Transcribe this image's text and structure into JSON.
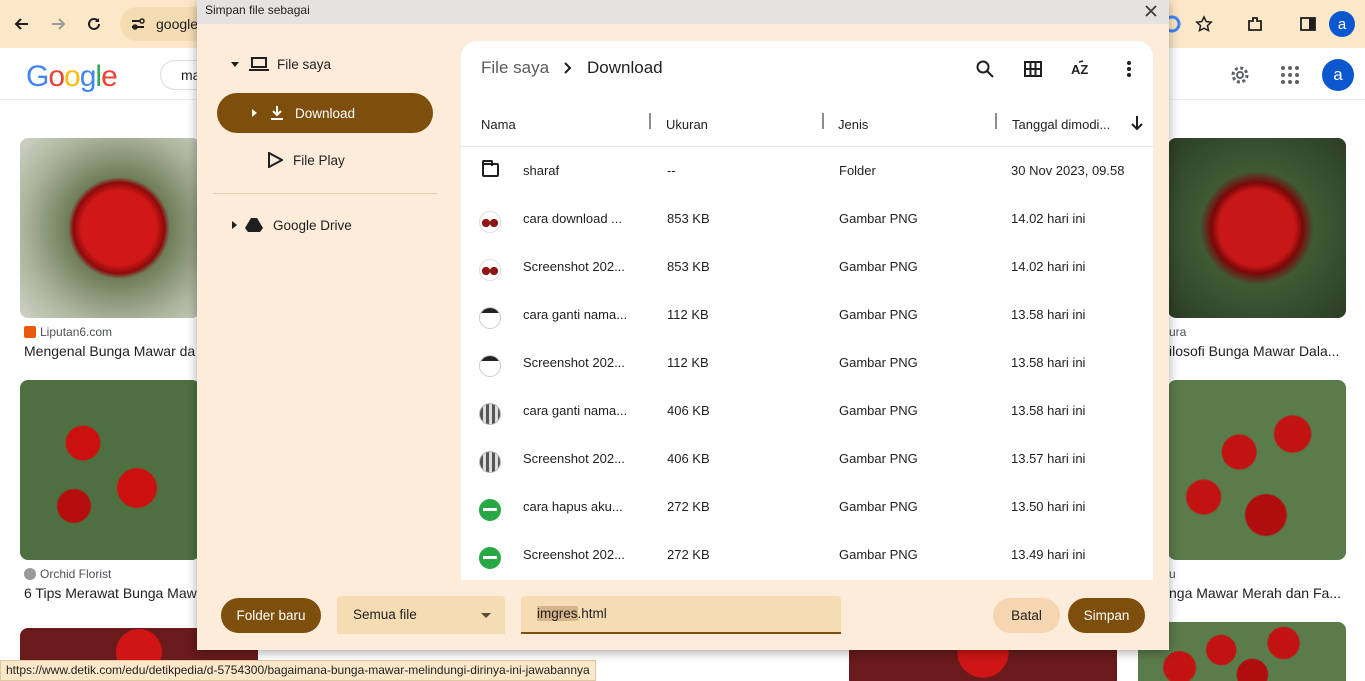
{
  "browser": {
    "omnibox_text": "google",
    "profile_initial": "a"
  },
  "google_page": {
    "search_text": "ma",
    "avatar_initial": "a",
    "results": [
      {
        "source": "Liputan6.com",
        "title": "Mengenal Bunga Mawar da"
      },
      {
        "source": "Orchid Florist",
        "title": "6 Tips Merawat Bunga Maw"
      },
      {
        "source": "ura",
        "title": "ilosofi Bunga Mawar Dala..."
      },
      {
        "source": "u",
        "title": "nga Mawar Merah dan Fa..."
      }
    ]
  },
  "dialog": {
    "title": "Simpan file sebagai",
    "nav": {
      "items": [
        {
          "label": "File saya",
          "icon": "laptop-icon"
        },
        {
          "label": "Download",
          "icon": "download-icon"
        },
        {
          "label": "File Play",
          "icon": "play-store-icon"
        },
        {
          "label": "Google Drive",
          "icon": "google-drive-icon"
        }
      ]
    },
    "breadcrumb": {
      "root": "File saya",
      "current": "Download"
    },
    "columns": {
      "name": "Nama",
      "size": "Ukuran",
      "type": "Jenis",
      "modified": "Tanggal dimodi..."
    },
    "files": [
      {
        "name": "sharaf",
        "size": "--",
        "type": "Folder",
        "modified": "30 Nov 2023, 09.58",
        "thumb": "folder"
      },
      {
        "name": "cara download ...",
        "size": "853 KB",
        "type": "Gambar PNG",
        "modified": "14.02 hari ini",
        "thumb": "rose"
      },
      {
        "name": "Screenshot 202...",
        "size": "853 KB",
        "type": "Gambar PNG",
        "modified": "14.02 hari ini",
        "thumb": "rose"
      },
      {
        "name": "cara ganti nama...",
        "size": "112 KB",
        "type": "Gambar PNG",
        "modified": "13.58 hari ini",
        "thumb": "win"
      },
      {
        "name": "Screenshot 202...",
        "size": "112 KB",
        "type": "Gambar PNG",
        "modified": "13.58 hari ini",
        "thumb": "win"
      },
      {
        "name": "cara ganti nama...",
        "size": "406 KB",
        "type": "Gambar PNG",
        "modified": "13.58 hari ini",
        "thumb": "grid"
      },
      {
        "name": "Screenshot 202...",
        "size": "406 KB",
        "type": "Gambar PNG",
        "modified": "13.57 hari ini",
        "thumb": "grid"
      },
      {
        "name": "cara hapus aku...",
        "size": "272 KB",
        "type": "Gambar PNG",
        "modified": "13.50 hari ini",
        "thumb": "green"
      },
      {
        "name": "Screenshot 202...",
        "size": "272 KB",
        "type": "Gambar PNG",
        "modified": "13.49 hari ini",
        "thumb": "green"
      }
    ],
    "footer": {
      "new_folder_label": "Folder baru",
      "file_type_value": "Semua file",
      "filename_selected": "imgres",
      "filename_ext": ".html",
      "cancel_label": "Batal",
      "save_label": "Simpan"
    }
  },
  "status_url": "https://www.detik.com/edu/detikpedia/d-5754300/bagaimana-bunga-mawar-melindungi-dirinya-ini-jawabannya",
  "colors": {
    "accent": "#7d4e0c",
    "dialog_bg": "#fcecd9",
    "field_bg": "#f6dcb3",
    "chrome_bg": "#fce8c8"
  }
}
